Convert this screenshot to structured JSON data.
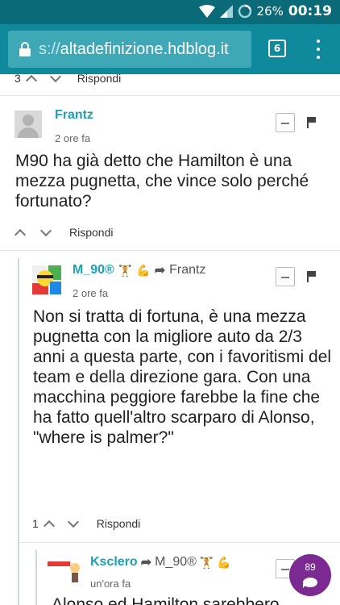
{
  "status_bar": {
    "battery": "26%",
    "time": "00:19"
  },
  "browser": {
    "url_scheme": "s://",
    "url_host": "altadefinizione.hdblog.it",
    "tab_count": "6"
  },
  "comments": [
    {
      "author": "",
      "votes": "3",
      "reply": "Rispondi"
    },
    {
      "author": "Frantz",
      "time": "2 ore fa",
      "text": "M90 ha già detto che Hamilton è una mezza pugnetta, che vince solo perché fortunato?",
      "votes": "",
      "reply": "Rispondi"
    },
    {
      "author": "M_90®",
      "reply_to": "Frantz",
      "time": "2 ore fa",
      "text": "Non si tratta di fortuna, è una mezza pugnetta con la migliore auto da 2/3 anni a questa parte, con i favoritismi del team e della direzione gara. Con una macchina peggiore farebbe la fine che ha fatto quell'altro scarparo di Alonso, \"where is palmer?\"",
      "votes": "1",
      "reply": "Rispondi"
    },
    {
      "author": "Ksclero",
      "reply_to": "M_90®",
      "time": "un'ora fa",
      "text": "Alonso ed Hamilton sarebbero"
    }
  ],
  "emojis": {
    "lifter": "🏋",
    "bicep": "💪"
  },
  "fab": {
    "count": "89"
  }
}
